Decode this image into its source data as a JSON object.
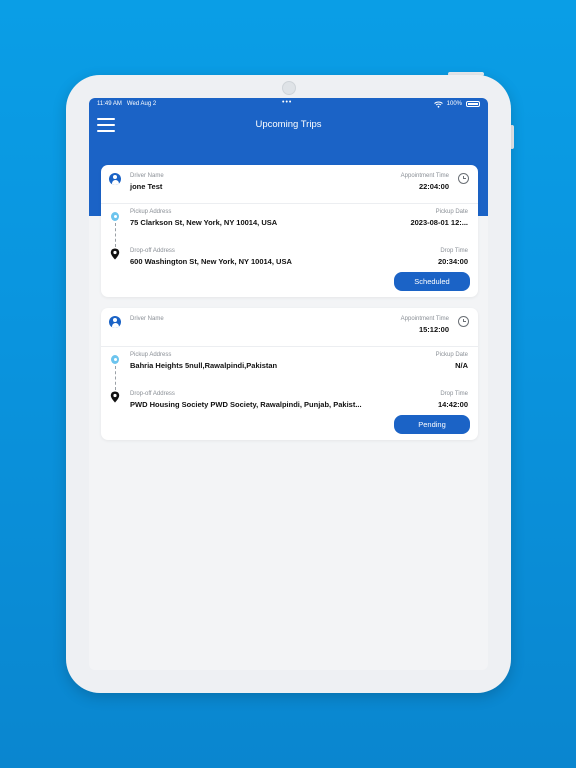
{
  "status_bar": {
    "time": "11:49 AM",
    "date": "Wed Aug 2",
    "battery": "100%"
  },
  "header": {
    "title": "Upcoming Trips"
  },
  "labels": {
    "driver_name": "Driver Name",
    "appointment_time": "Appointment Time",
    "pickup_address": "Pickup Address",
    "pickup_date": "Pickup Date",
    "dropoff_address": "Drop-off Address",
    "drop_time": "Drop Time"
  },
  "trips": [
    {
      "driver_name": "jone Test",
      "appointment_time": "22:04:00",
      "pickup_address": "75 Clarkson St, New York, NY 10014, USA",
      "pickup_date": "2023-08-01 12:...",
      "dropoff_address": "600 Washington St, New York, NY 10014, USA",
      "drop_time": "20:34:00",
      "status": "Scheduled"
    },
    {
      "driver_name": "",
      "appointment_time": "15:12:00",
      "pickup_address": "Bahria Heights 5null,Rawalpindi,Pakistan",
      "pickup_date": "N/A",
      "dropoff_address": "PWD Housing Society PWD Society, Rawalpindi, Punjab, Pakist...",
      "drop_time": "14:42:00",
      "status": "Pending"
    }
  ],
  "colors": {
    "primary": "#1b63c6",
    "background": "#0a9ee6",
    "pickup_pin": "#6cc4ee"
  },
  "icons": [
    "menu-icon",
    "user-icon",
    "clock-icon",
    "pickup-pin-icon",
    "dropoff-pin-icon",
    "wifi-icon",
    "battery-icon"
  ]
}
